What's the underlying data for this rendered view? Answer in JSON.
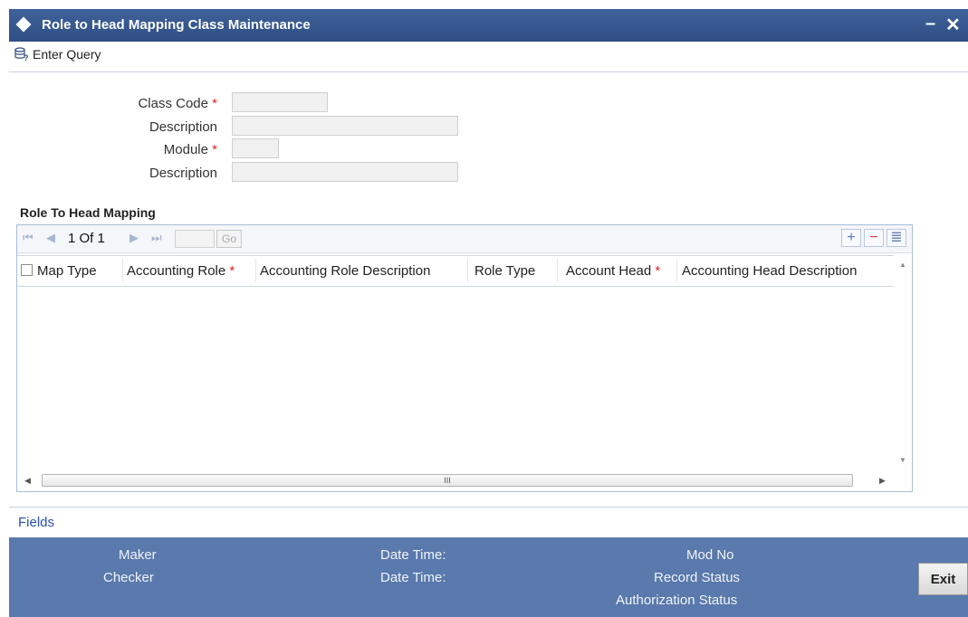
{
  "window": {
    "title": "Role to Head Mapping Class Maintenance",
    "minimize": "–",
    "close": "✕"
  },
  "toolbar": {
    "enter_query": "Enter Query",
    "enter_query_icon": "query-icon"
  },
  "form": {
    "class_code_label": "Class Code",
    "description_label_1": "Description",
    "module_label": "Module",
    "description_label_2": "Description",
    "required_mark": "*"
  },
  "section": {
    "title": "Role To Head Mapping"
  },
  "pager": {
    "page_text": "1 Of 1",
    "go_label": "Go",
    "first": "⏮",
    "prev": "◀",
    "next": "▶",
    "last": "⏭",
    "add": "+",
    "remove": "−",
    "list": "≣"
  },
  "table": {
    "columns": [
      {
        "label": "Map Type",
        "required": false
      },
      {
        "label": "Accounting Role",
        "required": true
      },
      {
        "label": "Accounting Role Description",
        "required": false
      },
      {
        "label": "Role Type",
        "required": false
      },
      {
        "label": "Account Head",
        "required": true
      },
      {
        "label": "Accounting Head Description",
        "required": false
      }
    ],
    "rows": [],
    "scroll_grip": "III"
  },
  "fields_link": "Fields",
  "footer": {
    "maker": "Maker",
    "checker": "Checker",
    "date_time_1": "Date Time:",
    "date_time_2": "Date Time:",
    "mod_no": "Mod No",
    "record_status": "Record Status",
    "authorization_status": "Authorization Status",
    "exit": "Exit"
  },
  "colors": {
    "title_bar": "#2f4f86",
    "footer": "#5a79ac",
    "required": "#e0201f",
    "link": "#2b4fb0"
  }
}
